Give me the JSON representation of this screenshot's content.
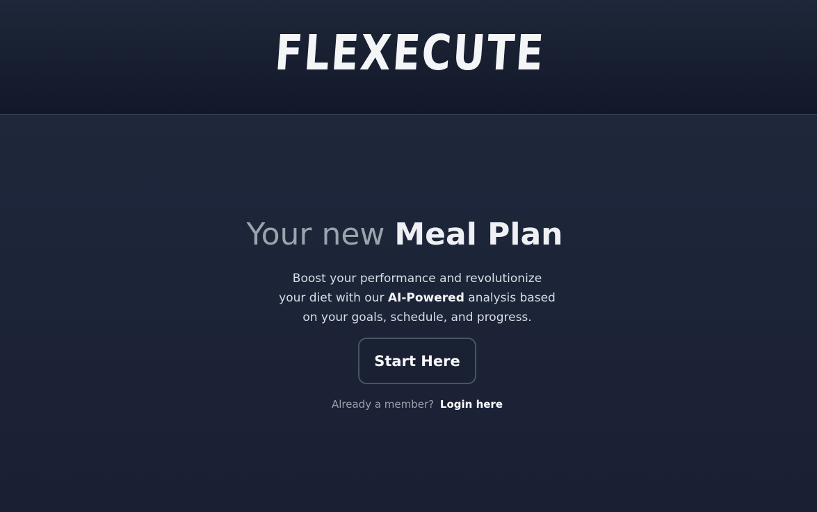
{
  "header": {
    "logo_text": "FLEXECUTE"
  },
  "hero": {
    "title_muted": "Your new",
    "title_strong": "Meal Plan",
    "subtext_part1": "Boost your performance and revolutionize your diet with our ",
    "subtext_bold": "AI-Powered",
    "subtext_part2": " analysis based on your goals, schedule, and progress.",
    "cta_label": "Start Here",
    "member_question": "Already a member?",
    "login_link": "Login here"
  },
  "colors": {
    "background": "#1b2236",
    "header_bg": "#111829",
    "text_primary": "#eef0f3",
    "text_muted": "#9ca3ab",
    "button_border": "#4a5466"
  }
}
